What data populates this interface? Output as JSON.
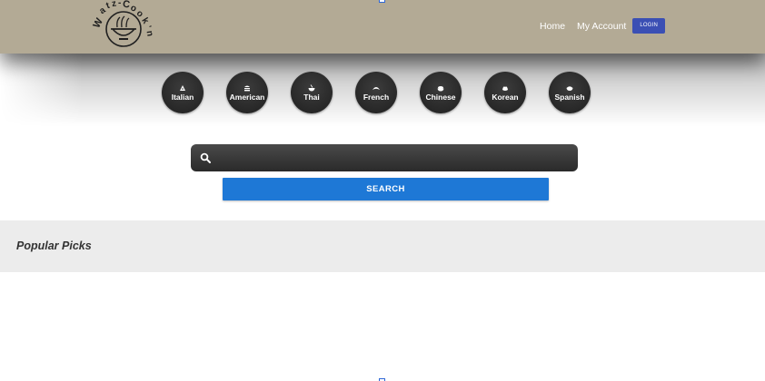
{
  "header": {
    "logo_text": "Watz-Cook'n",
    "nav": {
      "home": "Home",
      "account": "My Account",
      "login": "LOGIN"
    }
  },
  "cuisines": [
    {
      "label": "Italian",
      "icon": "pizza-icon"
    },
    {
      "label": "American",
      "icon": "burger-icon"
    },
    {
      "label": "Thai",
      "icon": "noodle-bowl-icon"
    },
    {
      "label": "French",
      "icon": "croissant-icon"
    },
    {
      "label": "Chinese",
      "icon": "rice-bowl-icon"
    },
    {
      "label": "Korean",
      "icon": "kimchi-icon"
    },
    {
      "label": "Spanish",
      "icon": "paella-icon"
    }
  ],
  "search": {
    "placeholder": "",
    "value": "",
    "button_label": "SEARCH"
  },
  "popular": {
    "title": "Popular Picks"
  },
  "colors": {
    "header_bg": "#b3aa95",
    "login_bg": "#3b4fb4",
    "search_button": "#1e78d6",
    "popular_bg": "#ececec"
  }
}
